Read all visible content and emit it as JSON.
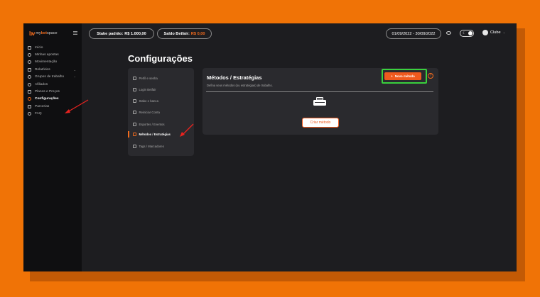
{
  "sidebar": {
    "logo_mark": "bv",
    "logo_prefix": "my",
    "logo_brand": "bet",
    "logo_suffix": "space",
    "items": [
      {
        "label": "Início"
      },
      {
        "label": "Minhas apostas"
      },
      {
        "label": "Movimentação"
      },
      {
        "label": "Relatórios"
      },
      {
        "label": "Grupos de trabalho"
      },
      {
        "label": "Afiliados"
      },
      {
        "label": "Planos e Preços"
      },
      {
        "label": "Configurações"
      },
      {
        "label": "Parcerias"
      },
      {
        "label": "FAQ"
      }
    ]
  },
  "topbar": {
    "stake_label": "Stake padrão:",
    "stake_value": "R$ 1.000,00",
    "balance_label": "Saldo Betfair:",
    "balance_value": "R$ 0,00",
    "date_range": "01/09/2022 - 30/09/2022",
    "user_name": "Clube"
  },
  "page": {
    "title": "Configurações"
  },
  "settings_nav": [
    {
      "label": "Perfil e senha"
    },
    {
      "label": "Login Betfair"
    },
    {
      "label": "Stake e banca"
    },
    {
      "label": "Reiniciar Conta"
    },
    {
      "label": "Esportes / Eventos"
    },
    {
      "label": "Métodos / Estratégias"
    },
    {
      "label": "Tags / Marcadores"
    }
  ],
  "card": {
    "title": "Métodos / Estratégias",
    "subtitle": "Defina seus métodos (ou estratégias) de trabalho.",
    "new_button": "Novo método",
    "new_button_icon": "+",
    "help_icon": "?",
    "create_button": "Criar método"
  },
  "colors": {
    "accent": "#ef5a1e",
    "highlight": "#39d13d",
    "frame": "#f07306"
  }
}
